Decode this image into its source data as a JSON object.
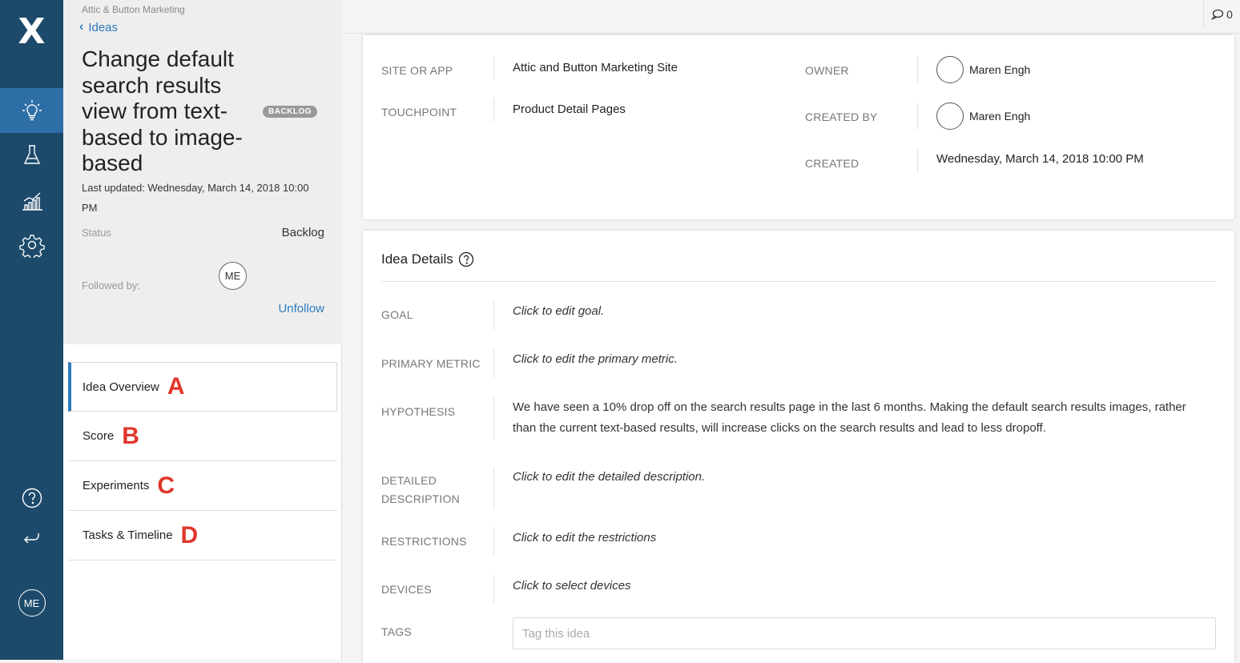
{
  "rail": {
    "logo": "X",
    "items": [
      {
        "icon": "lightbulb-icon",
        "active": true
      },
      {
        "icon": "flask-icon",
        "active": false
      },
      {
        "icon": "bar-chart-icon",
        "active": false
      },
      {
        "icon": "gear-icon",
        "active": false
      },
      {
        "icon": "help-icon",
        "active": false
      },
      {
        "icon": "return-icon",
        "active": false
      }
    ],
    "user_initials": "ME"
  },
  "panel": {
    "org_name": "Attic & Button Marketing",
    "back_label": "Ideas",
    "title": "Change default search results view from text-based to image-based",
    "badge": "BACKLOG",
    "last_updated": "Last updated: Wednesday, March 14, 2018 10:00 PM",
    "status_label": "Status",
    "status_value": "Backlog",
    "followed_label": "Followed by:",
    "follower_initials": "ME",
    "unfollow_label": "Unfollow",
    "menu": [
      {
        "label": "Idea Overview",
        "letter": "A",
        "active": true
      },
      {
        "label": "Score",
        "letter": "B",
        "active": false
      },
      {
        "label": "Experiments",
        "letter": "C",
        "active": false
      },
      {
        "label": "Tasks & Timeline",
        "letter": "D",
        "active": false
      }
    ]
  },
  "topbar": {
    "comment_count": "0"
  },
  "summary": {
    "site_label": "SITE OR APP",
    "site_value": "Attic and Button Marketing Site",
    "touchpoint_label": "TOUCHPOINT",
    "touchpoint_value": "Product Detail Pages",
    "owner_label": "OWNER",
    "owner_value": "Maren Engh",
    "created_by_label": "CREATED BY",
    "created_by_value": "Maren Engh",
    "created_label": "CREATED",
    "created_value": "Wednesday, March 14, 2018 10:00 PM"
  },
  "details": {
    "title": "Idea Details",
    "goal_label": "GOAL",
    "goal_value": "Click to edit goal.",
    "metric_label": "PRIMARY METRIC",
    "metric_value": "Click to edit the primary metric.",
    "hypothesis_label": "HYPOTHESIS",
    "hypothesis_value": "We have seen a 10% drop off on the search results page in the last 6 months. Making the default search results images, rather than the current text-based results, will increase clicks on the search results and lead to less dropoff.",
    "description_label_1": "DETAILED",
    "description_label_2": "DESCRIPTION",
    "description_value": "Click to edit the detailed description.",
    "restrictions_label": "RESTRICTIONS",
    "restrictions_value": "Click to edit the restrictions",
    "devices_label": "DEVICES",
    "devices_value": "Click to select devices",
    "tags_label": "TAGS",
    "tags_placeholder": "Tag this idea"
  }
}
